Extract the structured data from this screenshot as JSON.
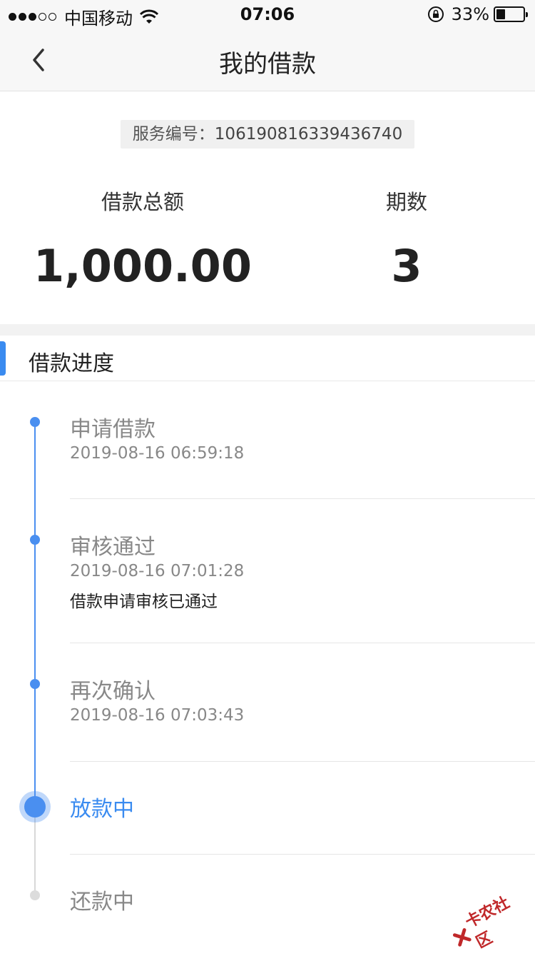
{
  "status_bar": {
    "carrier": "中国移动",
    "time": "07:06",
    "battery_pct_text": "33%",
    "battery_level": 0.33,
    "signal_bars_filled": 3,
    "signal_bars_total": 5
  },
  "nav": {
    "title": "我的借款",
    "back_icon": "chevron-left-icon"
  },
  "summary": {
    "service_label": "服务编号：",
    "service_number": "106190816339436740",
    "amount_label": "借款总额",
    "amount_value": "1,000.00",
    "periods_label": "期数",
    "periods_value": "3"
  },
  "progress": {
    "title": "借款进度",
    "steps": [
      {
        "title": "申请借款",
        "time": "2019-08-16 06:59:18"
      },
      {
        "title": "审核通过",
        "time": "2019-08-16 07:01:28",
        "note": "借款申请审核已通过"
      },
      {
        "title": "再次确认",
        "time": "2019-08-16 07:03:43"
      },
      {
        "title": "放款中"
      },
      {
        "title": "还款中"
      }
    ]
  },
  "colors": {
    "accent": "#3a8bf0",
    "muted": "#888888",
    "inactive_dot": "#dcdcdc"
  },
  "watermark": {
    "text": "卡农社区"
  }
}
